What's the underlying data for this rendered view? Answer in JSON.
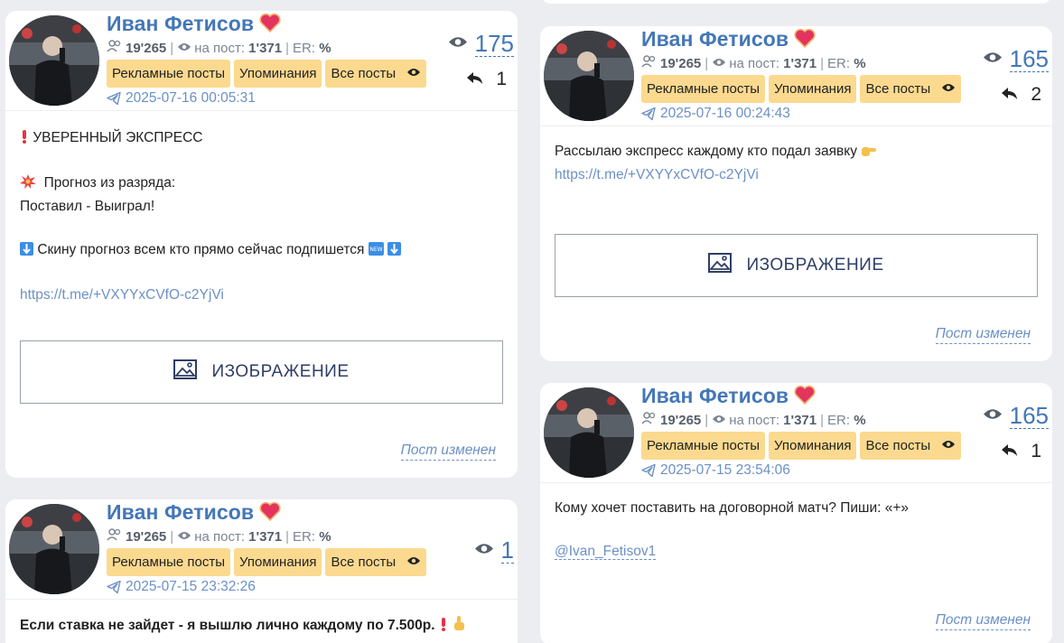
{
  "common": {
    "author": "Иван Фетисов",
    "subscribers": "19'265",
    "per_post_label": "на пост:",
    "per_post_value": "1'371",
    "er_label": "ER:",
    "er_value": "%",
    "btn_ads": "Рекламные посты",
    "btn_mentions": "Упоминания",
    "btn_all": "Все посты",
    "image_label": "ИЗОБРАЖЕНИЕ",
    "edited_label": "Пост изменен"
  },
  "posts": [
    {
      "date": "2025-07-16 00:05:31",
      "views": "175",
      "shares": "1",
      "lines": [
        "УВЕРЕННЫЙ ЭКСПРЕСС",
        "Прогноз из разряда:",
        "Поставил - Выиграл!",
        "Скину прогноз всем кто прямо сейчас подпишется",
        "https://t.me/+VXYYxCVfO-c2YjVi"
      ]
    },
    {
      "date": "2025-07-15 23:32:26",
      "views": "1",
      "lines": [
        "Если ставка не зайдет - я вышлю лично каждому по 7.500р."
      ]
    },
    {
      "date": "2025-07-16 00:24:43",
      "views": "165",
      "shares": "2",
      "lines": [
        "Рассылаю экспресс каждому кто подал заявку",
        "https://t.me/+VXYYxCVfO-c2YjVi"
      ]
    },
    {
      "date": "2025-07-15 23:54:06",
      "views": "165",
      "shares": "1",
      "lines": [
        "Кому хочет поставить на договорной матч? Пиши: «+»",
        "@Ivan_Fetisov1"
      ]
    }
  ]
}
